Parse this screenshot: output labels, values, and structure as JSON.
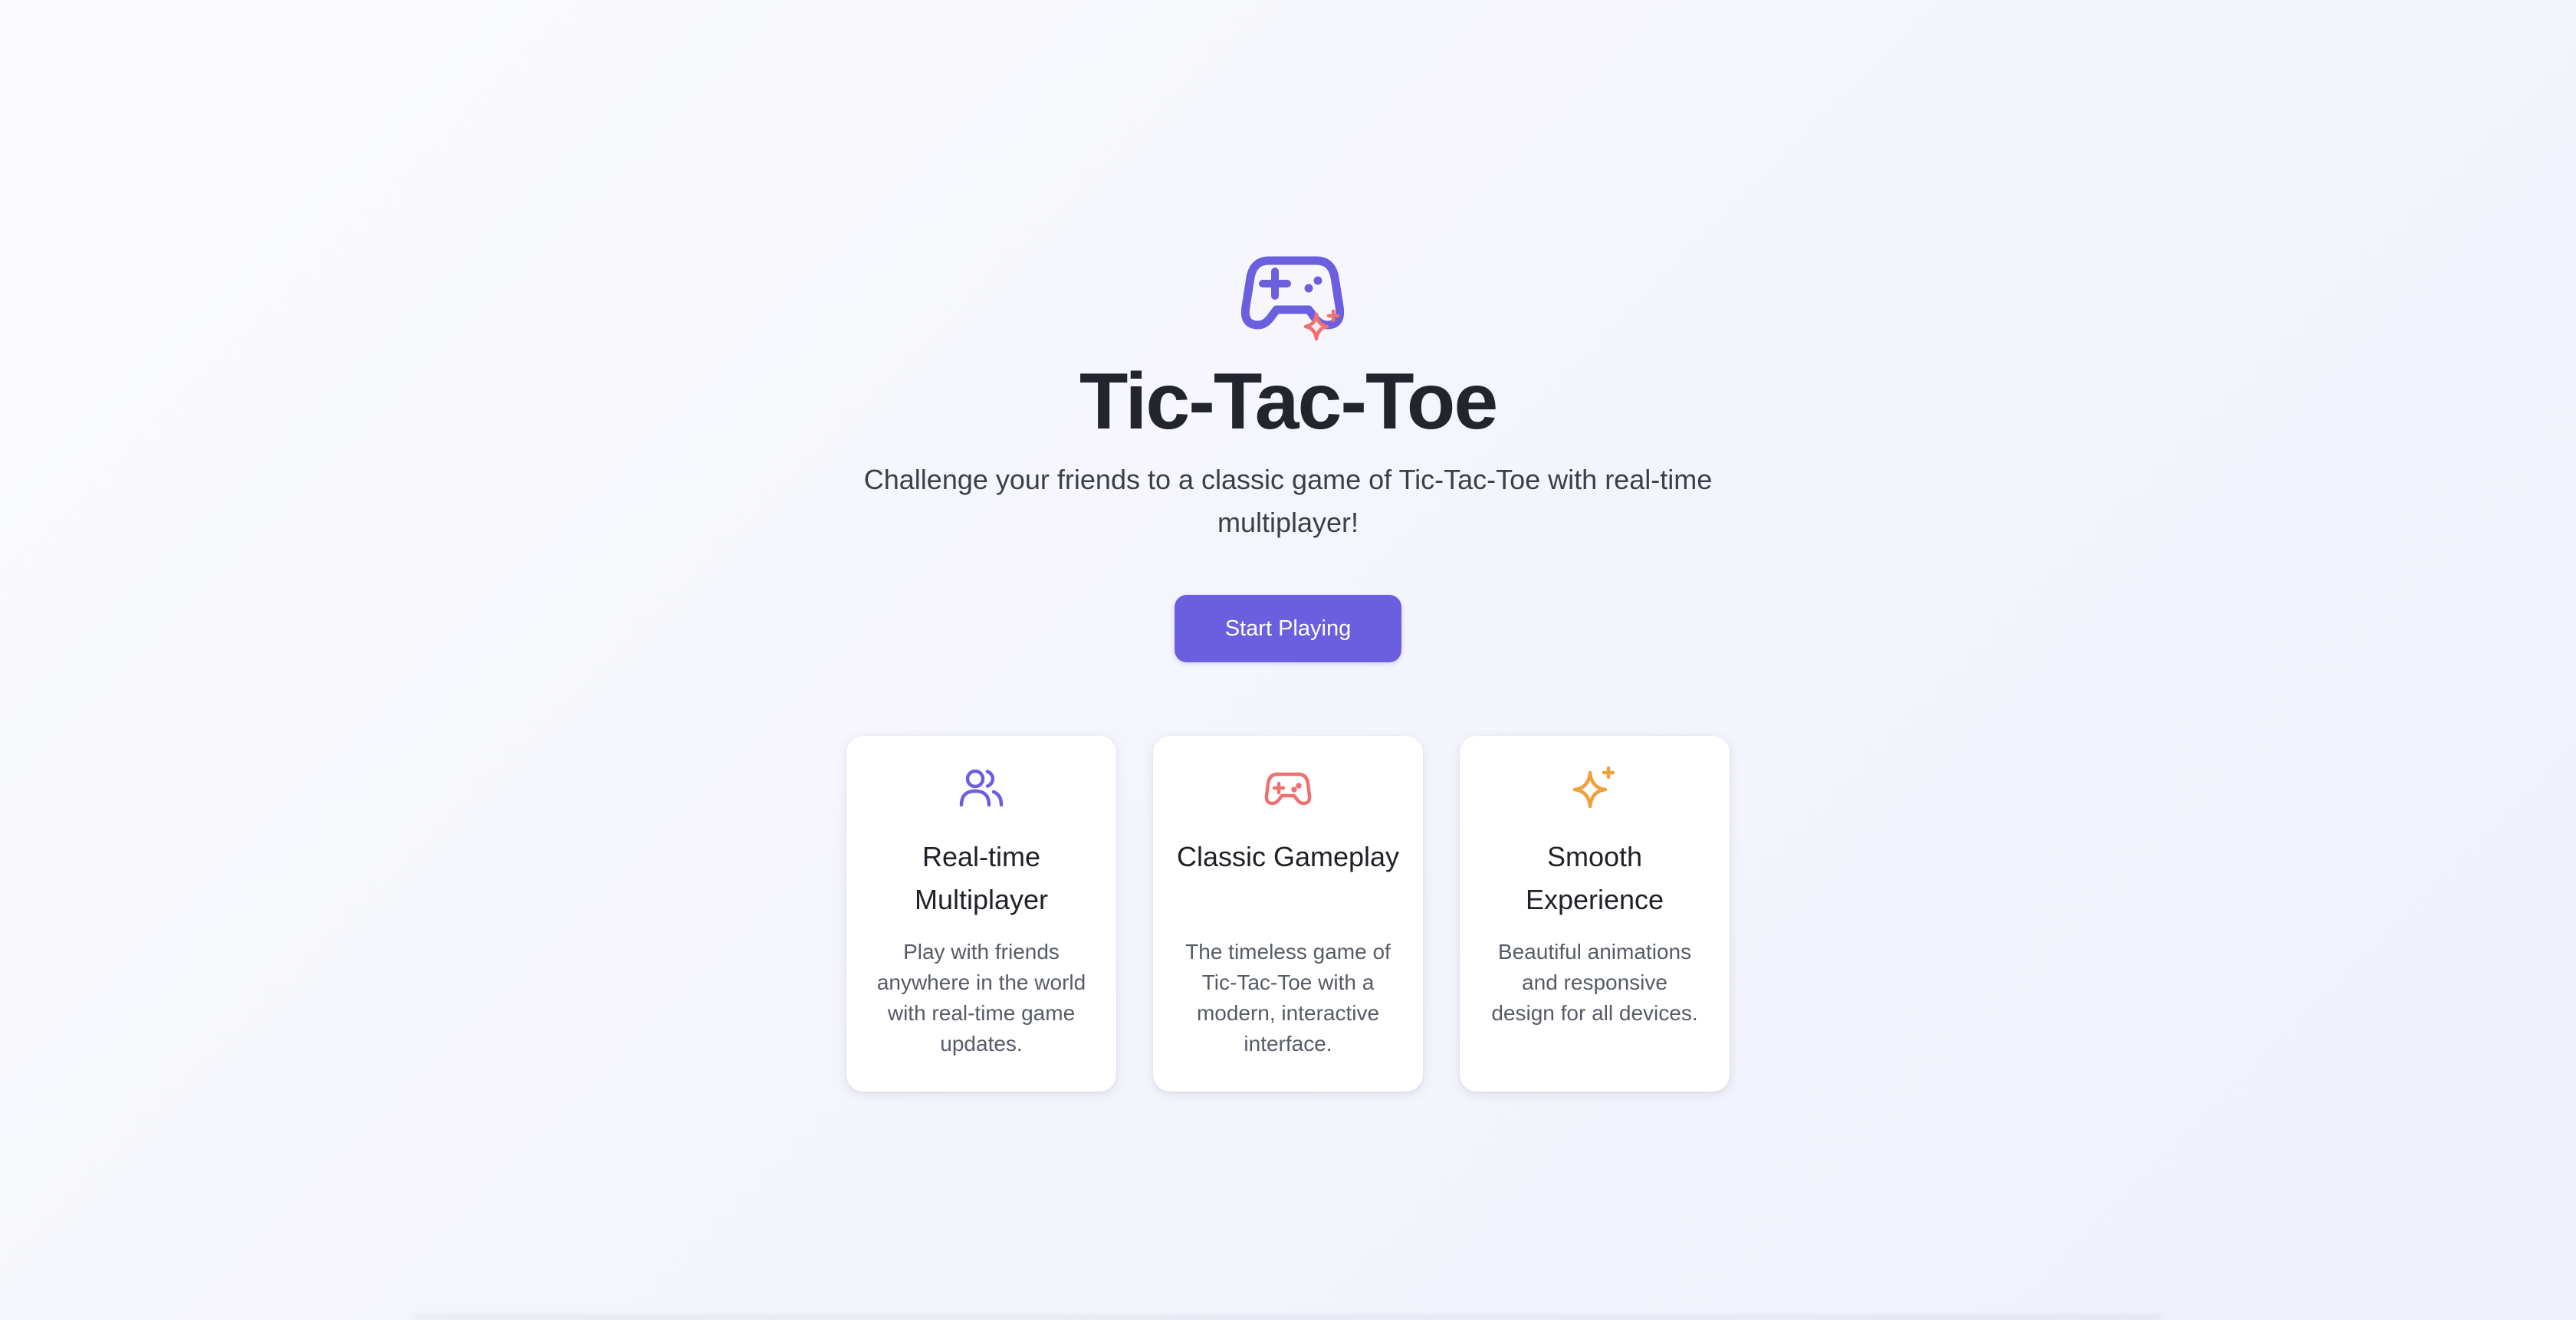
{
  "app": {
    "title": "Tic-Tac-Toe",
    "subtitle": "Challenge your friends to a classic game of Tic-Tac-Toe with real-time multiplayer!",
    "hero_icon": "gamepad-sparkle-icon"
  },
  "cta": {
    "label": "Start Playing"
  },
  "features": [
    {
      "icon": "users-icon",
      "title": "Real-time Multiplayer",
      "text": "Play with friends anywhere in the world with real-time game updates."
    },
    {
      "icon": "gamepad-icon",
      "title": "Classic Gameplay",
      "text": "The timeless game of Tic-Tac-Toe with a modern, interactive interface."
    },
    {
      "icon": "sparkles-icon",
      "title": "Smooth Experience",
      "text": "Beautiful animations and responsive design for all devices."
    }
  ],
  "colors": {
    "accent": "#6b5fe0",
    "coral": "#ef7070",
    "amber": "#eea13c",
    "title": "#22252d",
    "body_text": "#565b66"
  }
}
